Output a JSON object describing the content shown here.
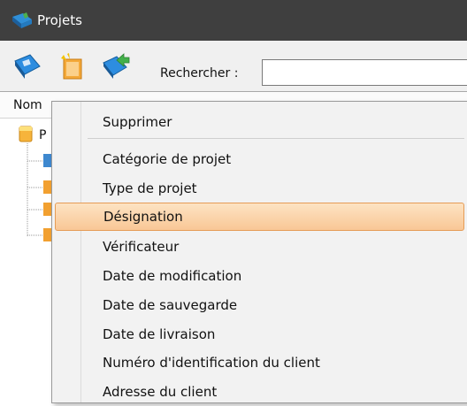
{
  "window": {
    "title": "Projets",
    "icon": "projects-app-icon"
  },
  "toolbar": {
    "buttons": [
      {
        "name": "open-project-button",
        "icon": "open-document-icon"
      },
      {
        "name": "new-project-button",
        "icon": "new-document-icon"
      },
      {
        "name": "export-project-button",
        "icon": "document-arrow-icon"
      }
    ],
    "search_label": "Rechercher :",
    "search_value": ""
  },
  "tree": {
    "column_header": "Nom",
    "root_letter": "P"
  },
  "context_menu": {
    "items": [
      {
        "label": "Supprimer"
      },
      {
        "label": "Catégorie de projet"
      },
      {
        "label": "Type de projet"
      },
      {
        "label": "Désignation",
        "highlighted": true
      },
      {
        "label": "Vérificateur"
      },
      {
        "label": "Date de modification"
      },
      {
        "label": "Date de sauvegarde"
      },
      {
        "label": "Date de livraison"
      },
      {
        "label": "Numéro d'identification du client"
      },
      {
        "label": "Adresse du client"
      }
    ]
  },
  "colors": {
    "titlebar": "#3f3f3f",
    "menu_highlight": "#f9c796",
    "menu_highlight_border": "#e59c56"
  }
}
